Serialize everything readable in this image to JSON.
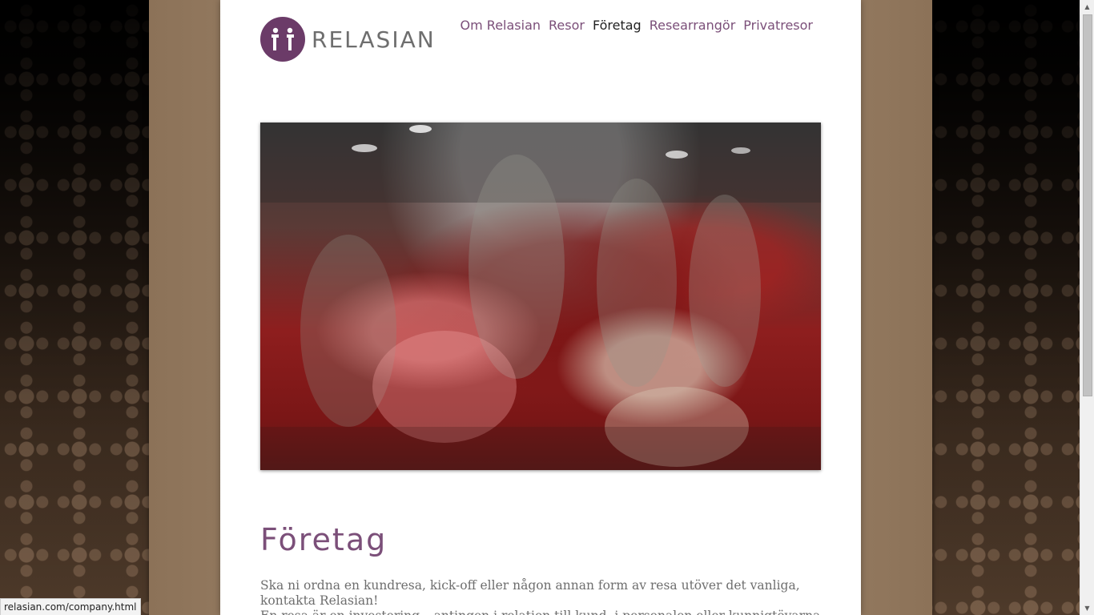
{
  "logo": {
    "text": "RELASIAN",
    "icon": "relasian-logo-mark-icon",
    "color": "#6b3b68"
  },
  "nav": {
    "items": [
      {
        "label": "Om Relasian"
      },
      {
        "label": "Resor"
      },
      {
        "label": "Företag",
        "active": true
      },
      {
        "label": "Researrangör"
      },
      {
        "label": "Privatresor"
      }
    ]
  },
  "page": {
    "title": "Företag",
    "paragraphs": [
      "Ska ni ordna en kundresa, kick-off eller någon annan form av resa utöver det vanliga, kontakta Relasian!",
      "En resa är en investering – antingen i relation till kund, i personalen eller kunnigtövarna ni"
    ]
  },
  "status_bar": {
    "url": "relasian.com/company.html"
  },
  "colors": {
    "accent": "#7b4f79",
    "text": "#6e6e6e",
    "frame": "#a48b71"
  }
}
